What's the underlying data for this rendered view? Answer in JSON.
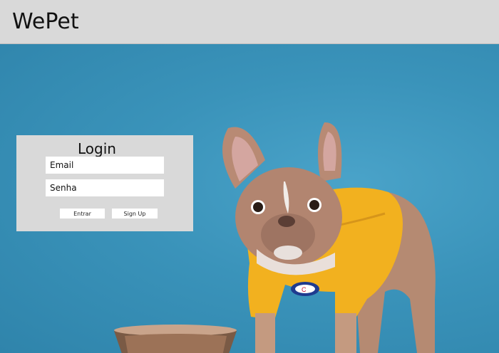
{
  "header": {
    "brand": "WePet"
  },
  "login": {
    "title": "Login",
    "email_placeholder": "Email",
    "password_placeholder": "Senha",
    "enter_label": "Entrar",
    "signup_label": "Sign Up"
  },
  "hero": {
    "image_subject": "french-bulldog-in-yellow-sweater",
    "background_color": "#3a91b8",
    "sweater_color": "#f2b11f"
  }
}
